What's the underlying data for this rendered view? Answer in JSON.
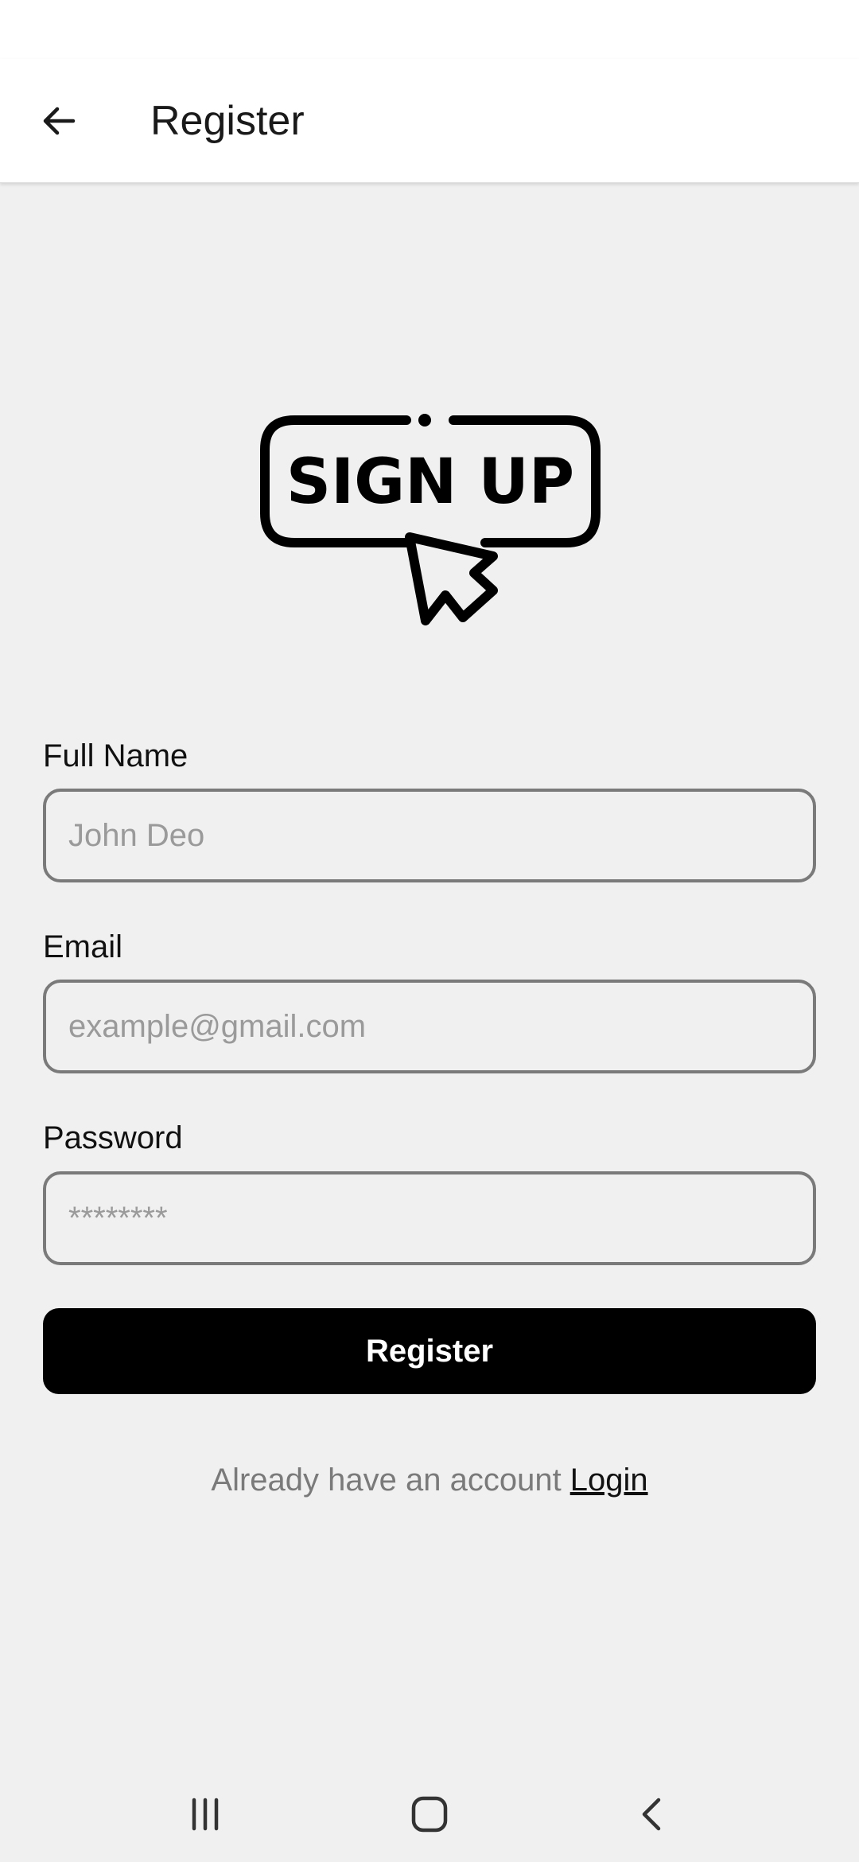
{
  "app_bar": {
    "title": "Register"
  },
  "logo": {
    "text": "SIGN UP"
  },
  "form": {
    "full_name": {
      "label": "Full Name",
      "placeholder": "John Deo",
      "value": ""
    },
    "email": {
      "label": "Email",
      "placeholder": "example@gmail.com",
      "value": ""
    },
    "password": {
      "label": "Password",
      "placeholder": "********",
      "value": ""
    },
    "submit_label": "Register"
  },
  "footer": {
    "prompt": "Already have an account",
    "login_label": "Login"
  },
  "icons": {
    "back": "arrow-left-icon",
    "nav_recents": "recents-icon",
    "nav_home": "home-icon",
    "nav_back": "chevron-left-icon"
  },
  "colors": {
    "background": "#f0f0f0",
    "app_bar": "#ffffff",
    "button": "#000000",
    "button_text": "#ffffff",
    "placeholder": "#9a9a9a",
    "input_border": "#7a7a7a",
    "muted_text": "#7a7a7a"
  }
}
